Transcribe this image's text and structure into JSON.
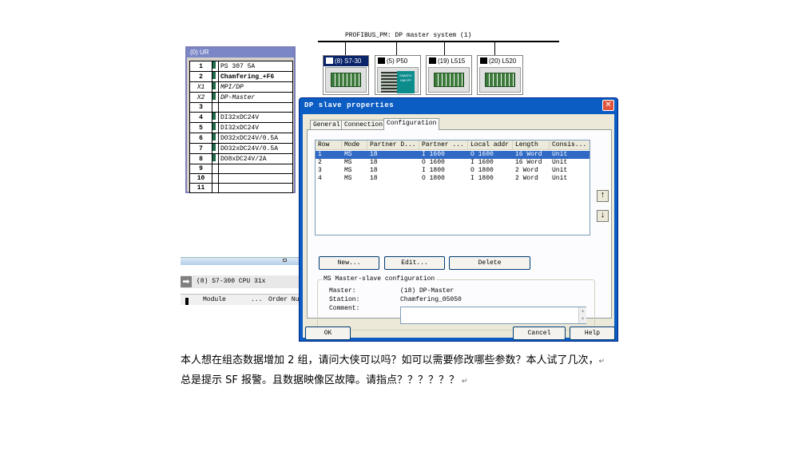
{
  "network": {
    "bus_label": "PROFIBUS_PM: DP master system (1)",
    "stations": [
      {
        "label": "(8) S7-30",
        "selected": true
      },
      {
        "label": "(5) P50",
        "panel_text": "SIMATIC HMI PP"
      },
      {
        "label": "(19) L515"
      },
      {
        "label": "(20) L520"
      }
    ]
  },
  "rack": {
    "title": "(0) UR",
    "rows": [
      {
        "slot": "1",
        "module": "PS 307 5A",
        "style": ""
      },
      {
        "slot": "2",
        "module": "Chamfering_+F6",
        "style": "bold"
      },
      {
        "slot": "X1",
        "module": "MPI/DP",
        "style": "ital"
      },
      {
        "slot": "X2",
        "module": "DP-Master",
        "style": "ital"
      },
      {
        "slot": "3",
        "module": "",
        "style": ""
      },
      {
        "slot": "4",
        "module": "DI32xDC24V",
        "style": ""
      },
      {
        "slot": "5",
        "module": "DI32xDC24V",
        "style": ""
      },
      {
        "slot": "6",
        "module": "DO32xDC24V/0.5A",
        "style": ""
      },
      {
        "slot": "7",
        "module": "DO32xDC24V/0.5A",
        "style": ""
      },
      {
        "slot": "8",
        "module": "DO8xDC24V/2A",
        "style": ""
      },
      {
        "slot": "9",
        "module": "",
        "style": ""
      },
      {
        "slot": "10",
        "module": "",
        "style": ""
      },
      {
        "slot": "11",
        "module": "",
        "style": ""
      }
    ]
  },
  "bottom_left": {
    "cpu_text": "(8)   S7-300 CPU 31x",
    "col_module": "Module",
    "col_dots": "...",
    "col_order": "Order Nu"
  },
  "dialog": {
    "title": "DP slave properties",
    "close": "✕",
    "tabs": [
      "General",
      "Connection",
      "Configuration"
    ],
    "active_tab": "Configuration",
    "columns": [
      "Row",
      "Mode",
      "Partner D...",
      "Partner ...",
      "Local addr",
      "Length",
      "Consis..."
    ],
    "rows": [
      [
        "1",
        "MS",
        "18",
        "I 1600",
        "O 1600",
        "16 Word",
        "Unit"
      ],
      [
        "2",
        "MS",
        "18",
        "O 1600",
        "I 1600",
        "16 Word",
        "Unit"
      ],
      [
        "3",
        "MS",
        "18",
        "I 1800",
        "O 1800",
        "2 Word",
        "Unit"
      ],
      [
        "4",
        "MS",
        "18",
        "O 1800",
        "I 1800",
        "2 Word",
        "Unit"
      ]
    ],
    "selected_row": 0,
    "up_arrow": "↑",
    "down_arrow": "↓",
    "buttons": {
      "new": "New...",
      "edit": "Edit...",
      "delete": "Delete"
    },
    "group": {
      "title": "MS Master-slave configuration",
      "master_label": "Master:",
      "master_value": "(18) DP-Master",
      "station_label": "Station:",
      "station_value": "Chamfering_05050",
      "comment_label": "Comment:",
      "comment_value": ""
    },
    "footer": {
      "ok": "OK",
      "cancel": "Cancel",
      "help": "Help"
    }
  },
  "caption": {
    "line1": "本人想在组态数据增加 2 组，请问大侠可以吗？如可以需要修改哪些参数？本人试了几次，",
    "line2": "总是提示 SF 报警。且数据映像区故障。请指点？？？？？？"
  },
  "colors": {
    "title_bar": "#0b5cc3",
    "selection": "#316ac5",
    "rack_title": "#7b86c7"
  }
}
